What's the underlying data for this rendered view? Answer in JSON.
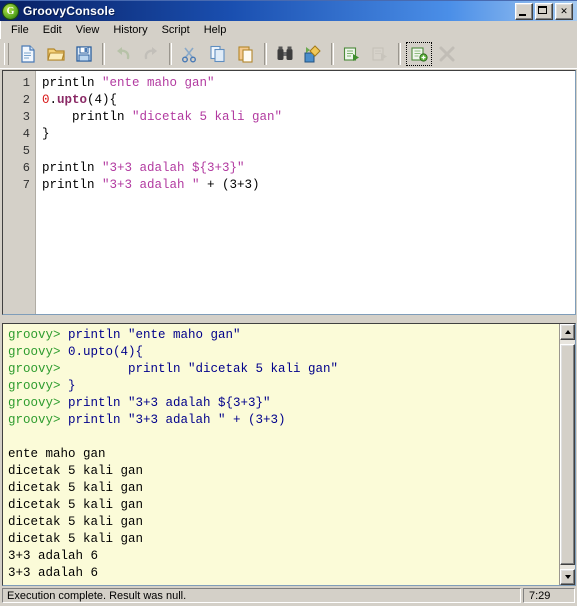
{
  "window": {
    "title": "GroovyConsole",
    "icon": "groovy-logo-icon",
    "minimize_label": "Minimize",
    "maximize_label": "Maximize",
    "close_label": "Close",
    "close_glyph": "✕"
  },
  "menu": {
    "items": [
      {
        "label": "File"
      },
      {
        "label": "Edit"
      },
      {
        "label": "View"
      },
      {
        "label": "History"
      },
      {
        "label": "Script"
      },
      {
        "label": "Help"
      }
    ]
  },
  "toolbar": {
    "buttons": [
      {
        "name": "new-file-button",
        "icon": "new-document-icon",
        "label": "New",
        "enabled": true,
        "focused": false
      },
      {
        "name": "open-file-button",
        "icon": "open-folder-icon",
        "label": "Open",
        "enabled": true,
        "focused": false
      },
      {
        "name": "save-file-button",
        "icon": "floppy-disk-icon",
        "label": "Save",
        "enabled": true,
        "focused": false
      },
      {
        "name": "undo-button",
        "icon": "undo-arrow-icon",
        "label": "Undo",
        "enabled": false,
        "focused": false
      },
      {
        "name": "redo-button",
        "icon": "redo-arrow-icon",
        "label": "Redo",
        "enabled": false,
        "focused": false
      },
      {
        "name": "cut-button",
        "icon": "scissors-icon",
        "label": "Cut",
        "enabled": true,
        "focused": false
      },
      {
        "name": "copy-button",
        "icon": "copy-pages-icon",
        "label": "Copy",
        "enabled": true,
        "focused": false
      },
      {
        "name": "paste-button",
        "icon": "clipboard-icon",
        "label": "Paste",
        "enabled": true,
        "focused": false
      },
      {
        "name": "find-button",
        "icon": "binoculars-icon",
        "label": "Find",
        "enabled": true,
        "focused": false
      },
      {
        "name": "replace-button",
        "icon": "find-replace-icon",
        "label": "Replace",
        "enabled": true,
        "focused": false
      },
      {
        "name": "execute-button",
        "icon": "run-script-icon",
        "label": "Execute",
        "enabled": true,
        "focused": false
      },
      {
        "name": "interrupt-button",
        "icon": "interrupt-icon",
        "label": "Interrupt",
        "enabled": false,
        "focused": false
      },
      {
        "name": "add-jar-button",
        "icon": "add-jar-icon",
        "label": "Add Jar",
        "enabled": true,
        "focused": true
      },
      {
        "name": "clear-output-button",
        "icon": "clear-x-icon",
        "label": "Clear Output",
        "enabled": false,
        "focused": false
      }
    ]
  },
  "editor": {
    "line_numbers": [
      "1",
      "2",
      "3",
      "4",
      "5",
      "6",
      "7"
    ],
    "lines": [
      [
        {
          "t": "println ",
          "c": "plain"
        },
        {
          "t": "\"ente maho gan\"",
          "c": "string"
        }
      ],
      [
        {
          "t": "0",
          "c": "number"
        },
        {
          "t": ".",
          "c": "plain"
        },
        {
          "t": "upto",
          "c": "method"
        },
        {
          "t": "(4){",
          "c": "plain"
        }
      ],
      [
        {
          "t": "    println ",
          "c": "plain"
        },
        {
          "t": "\"dicetak 5 kali gan\"",
          "c": "string"
        }
      ],
      [
        {
          "t": "}",
          "c": "plain"
        }
      ],
      [
        {
          "t": "",
          "c": "plain"
        }
      ],
      [
        {
          "t": "println ",
          "c": "plain"
        },
        {
          "t": "\"3+3 adalah ${3+3}\"",
          "c": "string"
        }
      ],
      [
        {
          "t": "println ",
          "c": "plain"
        },
        {
          "t": "\"3+3 adalah \"",
          "c": "string"
        },
        {
          "t": " + (3+3)",
          "c": "plain"
        }
      ]
    ]
  },
  "console": {
    "prompt": "groovy> ",
    "lines": [
      {
        "prompt": "groovy> ",
        "cmd": "println \"ente maho gan\""
      },
      {
        "prompt": "groovy> ",
        "cmd": "0.upto(4){"
      },
      {
        "prompt": "groovy> ",
        "cmd": "        println \"dicetak 5 kali gan\""
      },
      {
        "prompt": "groovy> ",
        "cmd": "}"
      },
      {
        "prompt": "groovy> ",
        "cmd": "println \"3+3 adalah ${3+3}\""
      },
      {
        "prompt": "groovy> ",
        "cmd": "println \"3+3 adalah \" + (3+3)"
      },
      {
        "prompt": "",
        "cmd": ""
      },
      {
        "out": "ente maho gan"
      },
      {
        "out": "dicetak 5 kali gan"
      },
      {
        "out": "dicetak 5 kali gan"
      },
      {
        "out": "dicetak 5 kali gan"
      },
      {
        "out": "dicetak 5 kali gan"
      },
      {
        "out": "dicetak 5 kali gan"
      },
      {
        "out": "3+3 adalah 6"
      },
      {
        "out": "3+3 adalah 6"
      }
    ]
  },
  "statusbar": {
    "message": "Execution complete. Result was null.",
    "caret_position": "7:29"
  },
  "colors": {
    "titlebar_start": "#0a246a",
    "titlebar_end": "#a6caf0",
    "window_face": "#d4d0c8",
    "editor_bg": "#ffffff",
    "console_bg": "#fbfbd8",
    "string_token": "#b23aa0",
    "number_token": "#d81616",
    "method_token": "#8a2a66",
    "console_prompt": "#2e9c2e",
    "console_command": "#00008b",
    "console_output": "#000000"
  }
}
